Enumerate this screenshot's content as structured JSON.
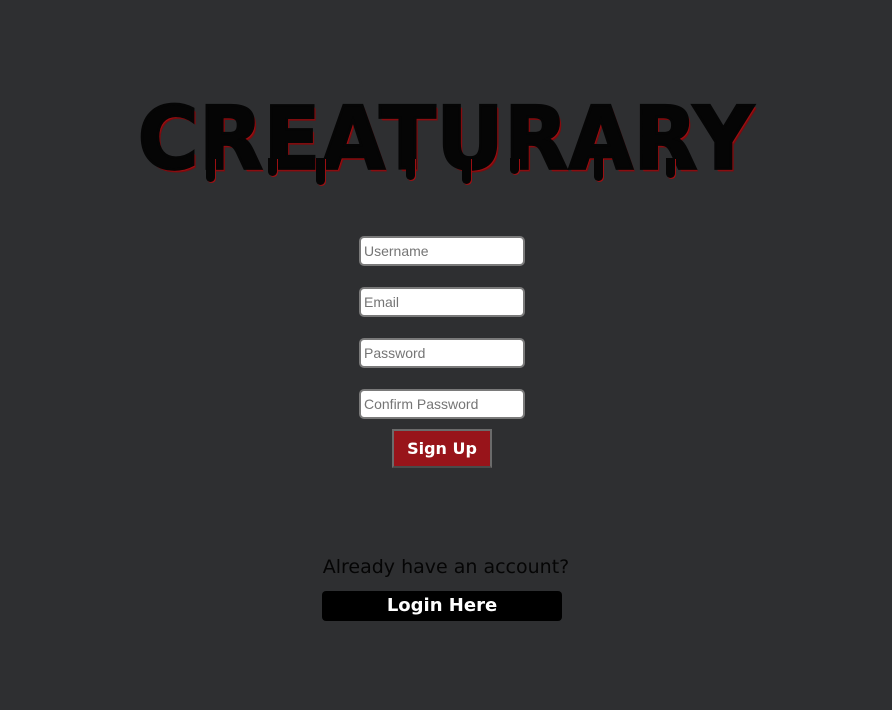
{
  "logo": {
    "text": "CREATURARY"
  },
  "form": {
    "username_placeholder": "Username",
    "email_placeholder": "Email",
    "password_placeholder": "Password",
    "confirm_password_placeholder": "Confirm Password",
    "signup_label": "Sign Up"
  },
  "login": {
    "prompt": "Already have an account?",
    "link_label": "Login Here"
  },
  "colors": {
    "background": "#2e2f31",
    "accent": "#98141a",
    "logo_outline": "#9c0f12"
  }
}
